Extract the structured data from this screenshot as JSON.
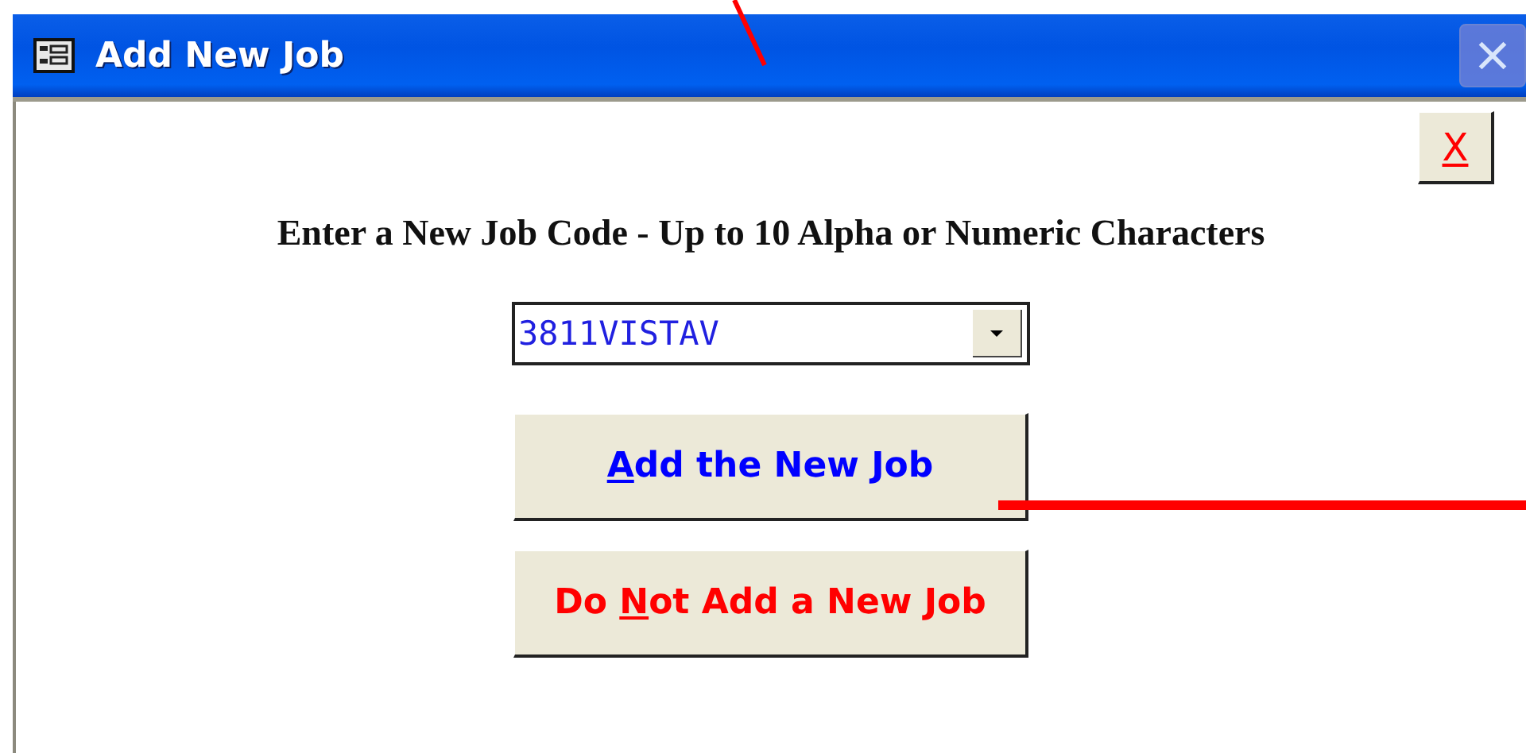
{
  "window": {
    "title": "Add New Job",
    "close_disabled": true
  },
  "form_close": {
    "label": {
      "key": "X"
    },
    "color": "#ff0000"
  },
  "heading": "Enter a New Job Code - Up to 10 Alpha or Numeric Characters",
  "job_code": {
    "value": "3811VISTAV"
  },
  "buttons": [
    {
      "label": {
        "key": "A",
        "post": "dd the New Job"
      },
      "color": "#0000ff"
    },
    {
      "label": {
        "pre": "Do ",
        "key": "N",
        "post": "ot Add a New Job"
      },
      "color": "#ff0000"
    }
  ]
}
